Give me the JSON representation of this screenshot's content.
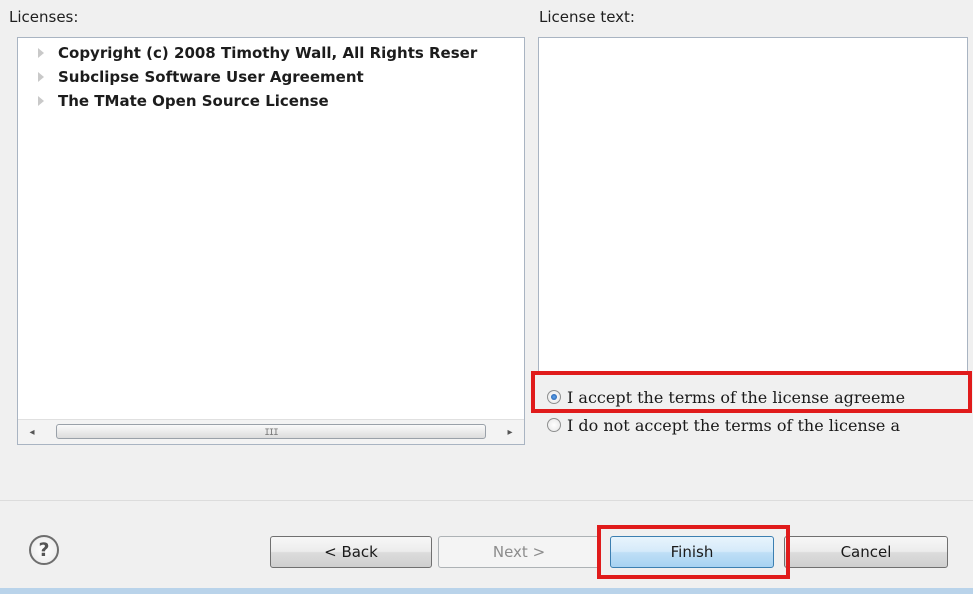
{
  "labels": {
    "licenses": "Licenses:",
    "license_text": "License text:"
  },
  "licenses": {
    "items": [
      {
        "label": "Copyright (c) 2008 Timothy Wall, All Rights Reser"
      },
      {
        "label": "Subclipse Software User Agreement"
      },
      {
        "label": "The TMate Open Source License"
      }
    ]
  },
  "scrollbar": {
    "left_glyph": "◂",
    "right_glyph": "▸",
    "grip": "III"
  },
  "license_text": {
    "content": ""
  },
  "radios": {
    "accept": {
      "label": "I accept the terms of the license agreeme",
      "checked": true
    },
    "reject": {
      "label": "I do not accept the terms of the license a",
      "checked": false
    }
  },
  "buttons": {
    "help": "?",
    "back": "< Back",
    "next": "Next >",
    "finish": "Finish",
    "cancel": "Cancel"
  },
  "colors": {
    "highlight": "#e01b1b",
    "finish_accent": "#3c7fb1"
  },
  "icons": {
    "help": "help-icon",
    "tree_expand": "triangle-right-icon"
  }
}
